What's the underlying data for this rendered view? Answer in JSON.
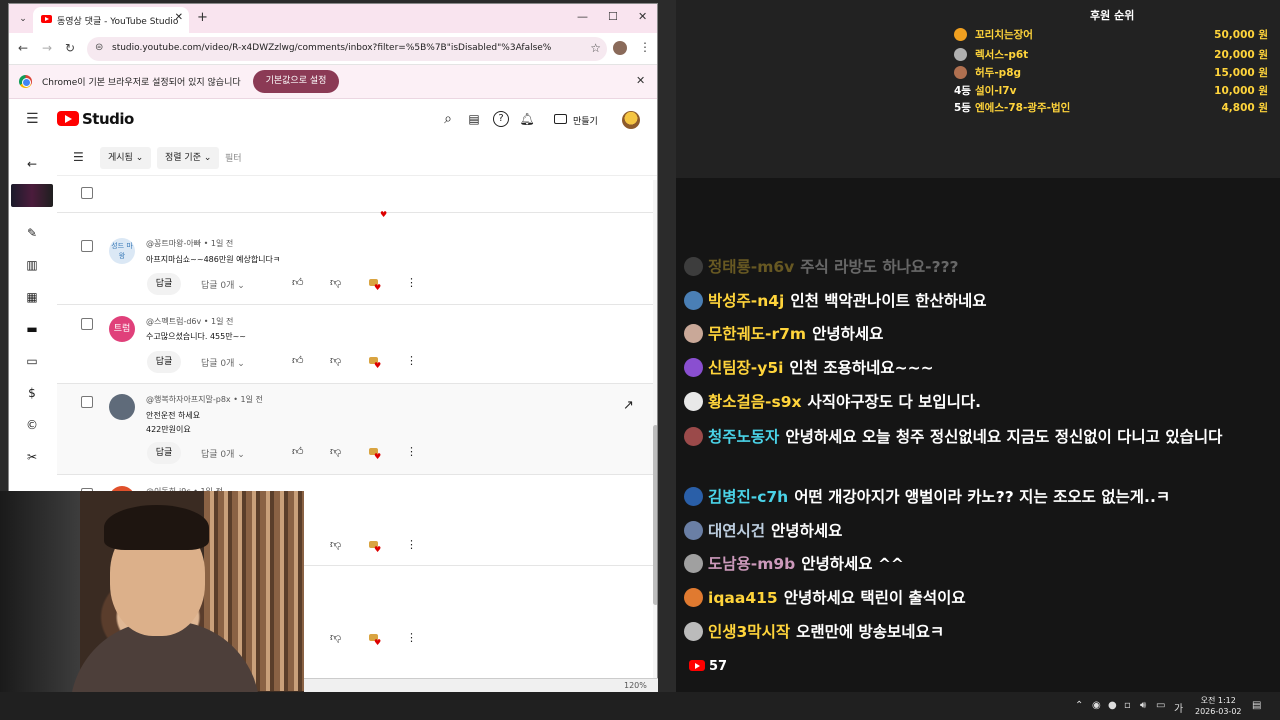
{
  "browser": {
    "tab_title": "동영상 댓글 - YouTube Studio",
    "new_tab": "+",
    "url": "studio.youtube.com/video/R-x4DWZzlwg/comments/inbox?filter=%5B%7B\"isDisabled\"%3Afalse%2C\"isPinn...",
    "infobar_text": "Chrome이 기본 브라우저로 설정되어 있지 않습니다",
    "infobar_button": "기본값으로 설정",
    "zoom": "120%"
  },
  "studio": {
    "logo_text": "Studio",
    "create_label": "만들기",
    "filter_chip_1": "게시됨",
    "filter_chip_2": "정렬 기준",
    "filter_placeholder": "필터"
  },
  "comments": [
    {
      "author": "@꽁트마왕-아빠",
      "time": "1일 전",
      "text": "아프지마십쇼~~486만원 예상합니다ㅋ",
      "reply_label": "답글",
      "reply_count": "답글 0개",
      "avatar_text": "성드\n마왕",
      "avatar_color": "#dbe8f5"
    },
    {
      "author": "@스펙트럼-d6v",
      "time": "1일 전",
      "text": "수고많으셨습니다. 455만~~",
      "reply_label": "답글",
      "reply_count": "답글 0개",
      "avatar_text": "트럼",
      "avatar_color": "#e0407a"
    },
    {
      "author": "@행복하자아프지말-p8x",
      "time": "1일 전",
      "text": "안전운전 하세요",
      "text2": "422만원이요",
      "reply_label": "답글",
      "reply_count": "답글 0개",
      "avatar_text": "",
      "avatar_color": "#5f6b7a"
    },
    {
      "author": "@이동희-j9c",
      "time": "1일 전",
      "avatar_color": "#e0502b"
    }
  ],
  "ranking": {
    "title": "후원 순위",
    "rows": [
      {
        "label": "",
        "name": "꼬리치는장어",
        "amount": "50,000 원",
        "medal": "#f0a020"
      },
      {
        "label": "",
        "name": "렉서스-p6t",
        "amount": "20,000 원",
        "medal": "#b0b0b0"
      },
      {
        "label": "",
        "name": "허두-p8g",
        "amount": "15,000 원",
        "medal": "#b07050"
      },
      {
        "label": "4등",
        "name": "설이-l7v",
        "amount": "10,000 원"
      },
      {
        "label": "5등",
        "name": "엔에스-78-광주-법인",
        "amount": "4,800 원"
      }
    ]
  },
  "chat": [
    {
      "nick": "정태룡-m6v",
      "msg": "주식 라방도 하나요-???",
      "color": "#888"
    },
    {
      "nick": "박성주-n4j",
      "msg": "인천 백악관나이트 한산하네요",
      "color": "#4a7fb5"
    },
    {
      "nick": "무한궤도-r7m",
      "msg": "안녕하세요",
      "color": "#c9a898"
    },
    {
      "nick": "신팀장-y5i",
      "msg": "인천 조용하네요~~~",
      "color": "#8a4fd0"
    },
    {
      "nick": "황소걸음-s9x",
      "msg": "사직야구장도 다 보입니다.",
      "color": "#e8e8e8"
    },
    {
      "nick": "청주노동자",
      "msg": "안녕하세요 오늘 청주 정신없네요 지금도 정신없이 다니고 있습니다",
      "color": "#9b4a4a"
    },
    {
      "nick": "김병진-c7h",
      "msg": "어떤 개강아지가 앵벌이라 카노?? 지는 조오도 없는게..ㅋ",
      "color": "#2a5fa8"
    },
    {
      "nick": "대연시건",
      "msg": "안녕하세요",
      "color": "#6a7fa5"
    },
    {
      "nick": "도남용-m9b",
      "msg": "안녕하세요 ^^",
      "color": "#a0a0a0"
    },
    {
      "nick": "iqaa415",
      "msg": "안녕하세요 택린이 출석이요",
      "color": "#e07a30"
    },
    {
      "nick": "인생3막시작",
      "msg": "오랜만에 방송보네요ㅋ",
      "color": "#bbb"
    }
  ],
  "chat_viewers": "57",
  "taskbar": {
    "time": "오전 1:12",
    "date": "2026-03-02"
  }
}
